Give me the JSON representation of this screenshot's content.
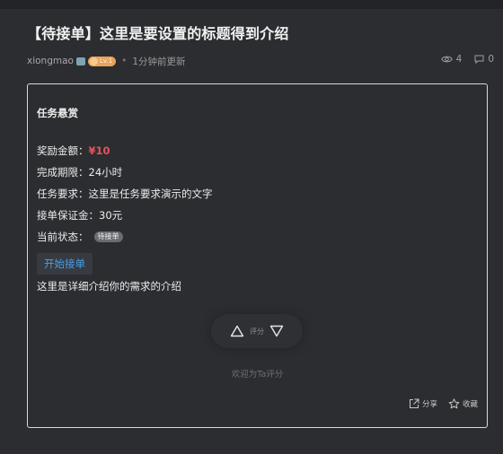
{
  "header": {
    "title": "【待接单】这里是要设置的标题得到介绍",
    "author": "xiongmao",
    "level_badge": "Lv.1",
    "separator": "•",
    "updated": "1分钟前更新",
    "views": "4",
    "comments": "0"
  },
  "task": {
    "section_title": "任务悬赏",
    "reward_label": "奖励金额：",
    "reward_value": "¥10",
    "deadline_label": "完成期限：",
    "deadline_value": "24小时",
    "requirement_label": "任务要求：",
    "requirement_value": "这里是任务要求演示的文字",
    "deposit_label": "接单保证金：",
    "deposit_value": "30元",
    "status_label": "当前状态：",
    "status_value": "待接单",
    "accept_label": "开始接单",
    "description": "这里是详细介绍你的需求的介绍"
  },
  "rating": {
    "label": "评分",
    "welcome": "欢迎为Ta评分"
  },
  "actions": {
    "share": "分享",
    "favorite": "收藏"
  },
  "colors": {
    "background": "#2b2d30",
    "price": "#e8515b",
    "link": "#4a9fe8",
    "badge": "#e8a45a"
  }
}
